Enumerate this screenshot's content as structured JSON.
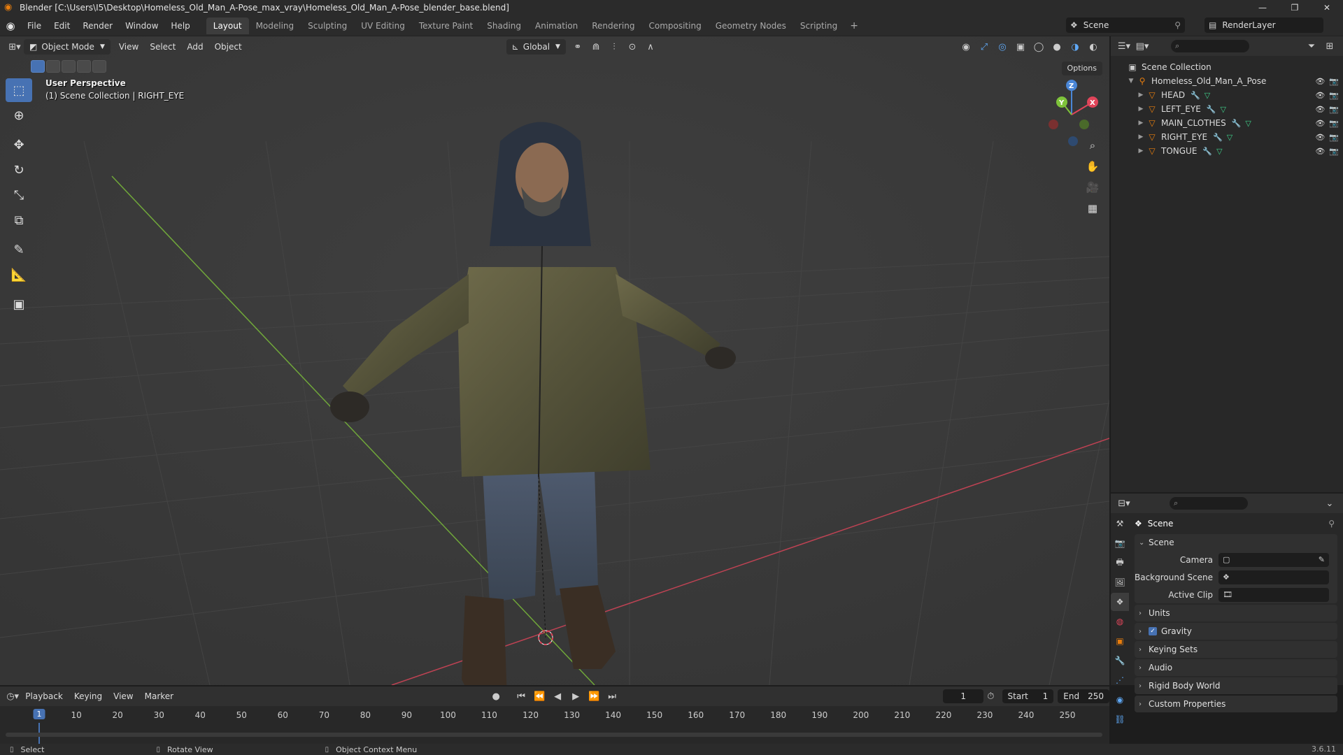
{
  "titlebar": {
    "title": "Blender [C:\\Users\\I5\\Desktop\\Homeless_Old_Man_A-Pose_max_vray\\Homeless_Old_Man_A-Pose_blender_base.blend]",
    "minimize": "—",
    "maximize": "❐",
    "close": "✕"
  },
  "menu": [
    "File",
    "Edit",
    "Render",
    "Window",
    "Help"
  ],
  "workspaces": [
    "Layout",
    "Modeling",
    "Sculpting",
    "UV Editing",
    "Texture Paint",
    "Shading",
    "Animation",
    "Rendering",
    "Compositing",
    "Geometry Nodes",
    "Scripting"
  ],
  "workspace_add": "+",
  "scene_name": "Scene",
  "view_layer": "RenderLayer",
  "viewport": {
    "mode": "Object Mode",
    "menus": [
      "View",
      "Select",
      "Add",
      "Object"
    ],
    "orientation": "Global",
    "options": "Options",
    "info_line1": "User Perspective",
    "info_line2": "(1) Scene Collection | RIGHT_EYE",
    "gizmo_z": "Z",
    "gizmo_x": "X",
    "gizmo_y": "Y"
  },
  "outliner": {
    "root": "Scene Collection",
    "object": "Homeless_Old_Man_A_Pose",
    "children": [
      "HEAD",
      "LEFT_EYE",
      "MAIN_CLOTHES",
      "RIGHT_EYE",
      "TONGUE"
    ]
  },
  "properties": {
    "context": "Scene",
    "panel_scene": "Scene",
    "camera_label": "Camera",
    "bg_scene_label": "Background Scene",
    "active_clip_label": "Active Clip",
    "panels": [
      "Units",
      "Gravity",
      "Keying Sets",
      "Audio",
      "Rigid Body World",
      "Custom Properties"
    ]
  },
  "timeline": {
    "menus": [
      "Playback",
      "Keying",
      "View",
      "Marker"
    ],
    "current_frame": "1",
    "start_label": "Start",
    "start_value": "1",
    "end_label": "End",
    "end_value": "250",
    "ticks": [
      "1",
      "10",
      "20",
      "30",
      "40",
      "50",
      "60",
      "70",
      "80",
      "90",
      "100",
      "110",
      "120",
      "130",
      "140",
      "150",
      "160",
      "170",
      "180",
      "190",
      "200",
      "210",
      "220",
      "230",
      "240",
      "250"
    ]
  },
  "statusbar": {
    "select": "Select",
    "rotate": "Rotate View",
    "context_menu": "Object Context Menu",
    "version": "3.6.11"
  },
  "colors": {
    "accent": "#4772b3",
    "x_axis": "#e0455a",
    "y_axis": "#7ec33a",
    "z_axis": "#4a86d6",
    "object_orange": "#e87d0d"
  }
}
